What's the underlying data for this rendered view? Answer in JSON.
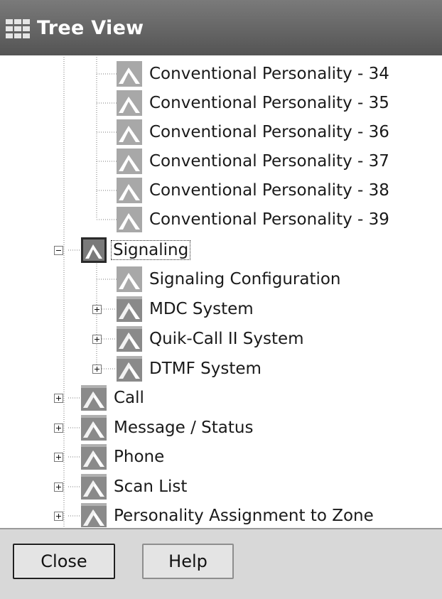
{
  "window": {
    "title": "Tree View",
    "icon": "grid-window-icon"
  },
  "tree": {
    "personalities": [
      "Conventional Personality - 34",
      "Conventional Personality - 35",
      "Conventional Personality - 36",
      "Conventional Personality - 37",
      "Conventional Personality - 38",
      "Conventional Personality - 39"
    ],
    "signaling": {
      "label": "Signaling",
      "expanded": true,
      "children": [
        {
          "label": "Signaling Configuration",
          "expandable": false
        },
        {
          "label": "MDC System",
          "expandable": true
        },
        {
          "label": "Quik-Call II System",
          "expandable": true
        },
        {
          "label": "DTMF System",
          "expandable": true
        }
      ]
    },
    "top_items": [
      {
        "label": "Call"
      },
      {
        "label": "Message / Status"
      },
      {
        "label": "Phone"
      },
      {
        "label": "Scan List"
      },
      {
        "label": "Personality Assignment to Zone"
      }
    ]
  },
  "buttons": {
    "close": "Close",
    "help": "Help"
  }
}
